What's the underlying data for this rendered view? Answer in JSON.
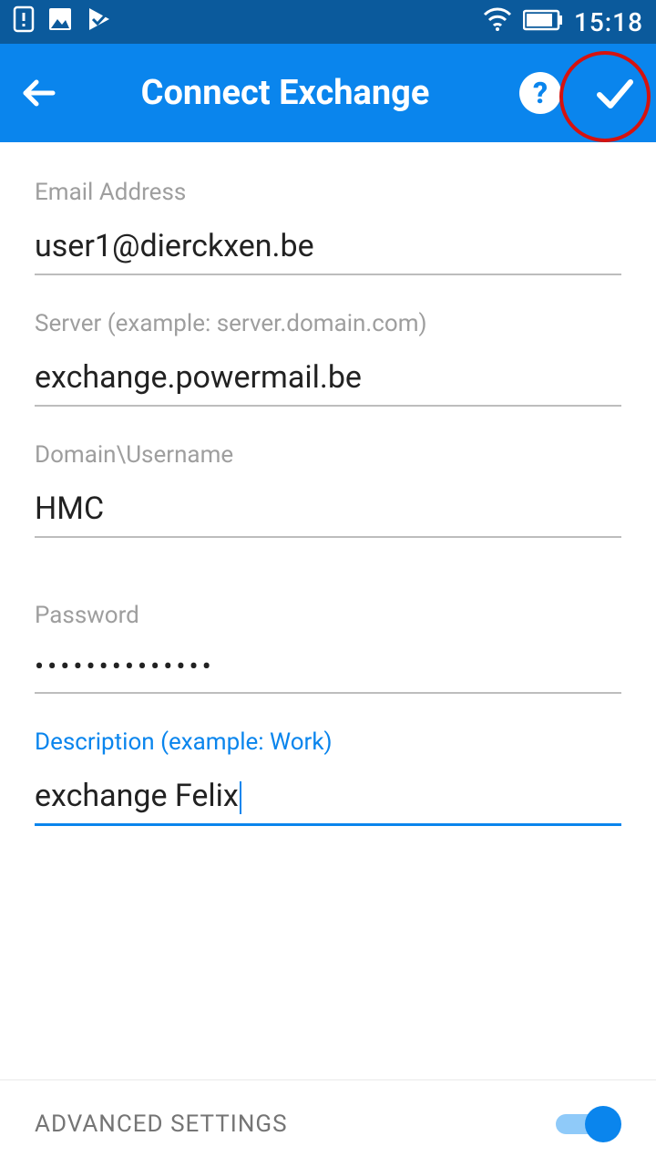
{
  "status": {
    "time": "15:18"
  },
  "appbar": {
    "title": "Connect Exchange"
  },
  "fields": {
    "email": {
      "label": "Email Address",
      "value": "user1@dierckxen.be"
    },
    "server": {
      "label": "Server (example: server.domain.com)",
      "value": "exchange.powermail.be"
    },
    "domain": {
      "label": "Domain\\Username",
      "value": "HMC"
    },
    "password": {
      "label": "Password",
      "value": "••••••••••••••"
    },
    "desc": {
      "label": "Description (example: Work)",
      "value": "exchange Felix"
    }
  },
  "footer": {
    "label": "ADVANCED SETTINGS",
    "toggle_on": true
  }
}
